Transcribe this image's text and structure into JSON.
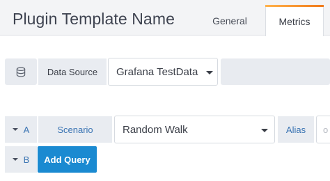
{
  "header": {
    "title": "Plugin Template Name",
    "tabs": [
      {
        "label": "General",
        "active": false
      },
      {
        "label": "Metrics",
        "active": true
      }
    ],
    "accent_color": "#f59e26"
  },
  "datasource_row": {
    "icon": "database-icon",
    "label": "Data Source",
    "selected": "Grafana TestData"
  },
  "queries": [
    {
      "letter": "A",
      "scenario_label": "Scenario",
      "scenario_value": "Random Walk",
      "alias_label": "Alias",
      "alias_placeholder": "o"
    },
    {
      "letter": "B",
      "add_query_label": "Add Query"
    }
  ],
  "colors": {
    "add_query_button": "#1a8ad1",
    "label_blue": "#3a74b3"
  }
}
